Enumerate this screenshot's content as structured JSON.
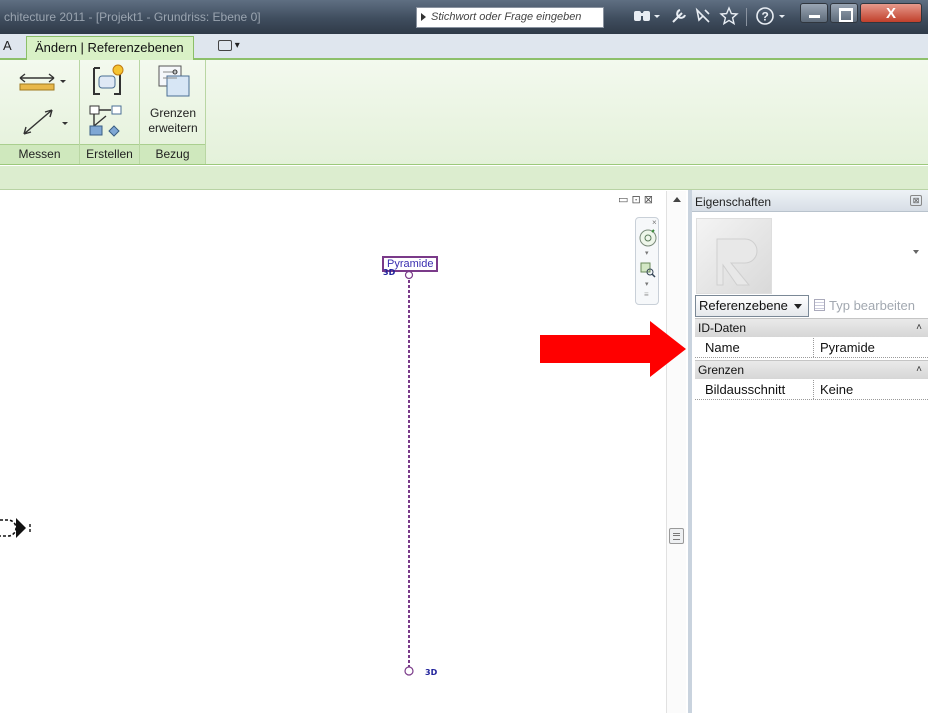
{
  "titlebar": {
    "title": "chitecture 2011 - [Projekt1 - Grundriss: Ebene 0]",
    "search_placeholder": "Stichwort oder Frage eingeben",
    "icons": [
      "binoculars-icon",
      "tools-icon",
      "satellite-icon",
      "star-icon",
      "help-icon"
    ]
  },
  "tabs": {
    "left_label": "A",
    "active": "Ändern | Referenzebenen"
  },
  "ribbon": {
    "panels": [
      {
        "label": "Messen"
      },
      {
        "label": "Erstellen"
      },
      {
        "label": "Bezug",
        "button_label_1": "Grenzen",
        "button_label_2": "erweitern"
      }
    ]
  },
  "canvas": {
    "view_controls": "▭ ⊡ ⊠",
    "ref_plane_name": "Pyramide",
    "tag_top": "3D",
    "tag_bottom": "3D",
    "pointer_color": "#ff0000",
    "ref_plane_color": "#7a3a89"
  },
  "properties": {
    "title": "Eigenschaften",
    "type_selector": "Referenzebene",
    "edit_type": "Typ bearbeiten",
    "groups": [
      {
        "name": "ID-Daten",
        "rows": [
          {
            "key": "Name",
            "value": "Pyramide"
          }
        ]
      },
      {
        "name": "Grenzen",
        "rows": [
          {
            "key": "Bildausschnitt",
            "value": "Keine"
          }
        ]
      }
    ]
  }
}
